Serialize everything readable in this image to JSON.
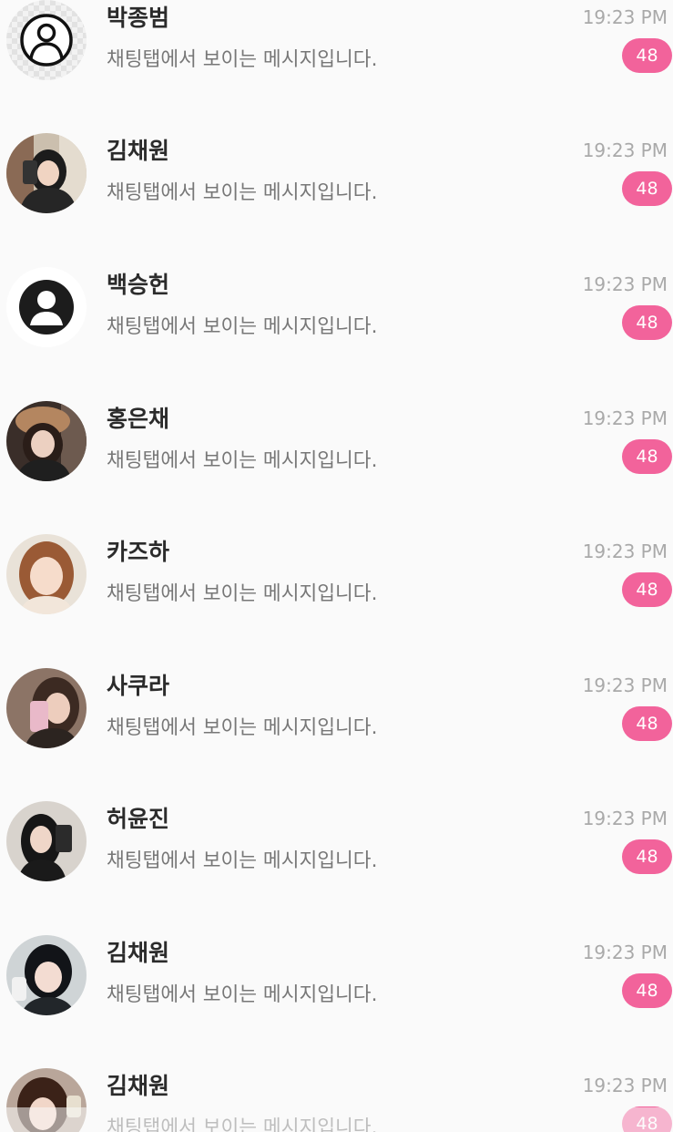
{
  "colors": {
    "badge": "#f2639b",
    "background": "#fafafa"
  },
  "chats": [
    {
      "name": "박종범",
      "preview": "채팅탭에서 보이는 메시지입니다.",
      "time": "19:23 PM",
      "unread": "48",
      "avatar": "outline-person-icon"
    },
    {
      "name": "김채원",
      "preview": "채팅탭에서 보이는 메시지입니다.",
      "time": "19:23 PM",
      "unread": "48",
      "avatar": "profile-photo"
    },
    {
      "name": "백승헌",
      "preview": "채팅탭에서 보이는 메시지입니다.",
      "time": "19:23 PM",
      "unread": "48",
      "avatar": "filled-person-icon"
    },
    {
      "name": "홍은채",
      "preview": "채팅탭에서 보이는 메시지입니다.",
      "time": "19:23 PM",
      "unread": "48",
      "avatar": "profile-photo"
    },
    {
      "name": "카즈하",
      "preview": "채팅탭에서 보이는 메시지입니다.",
      "time": "19:23 PM",
      "unread": "48",
      "avatar": "profile-photo"
    },
    {
      "name": "사쿠라",
      "preview": "채팅탭에서 보이는 메시지입니다.",
      "time": "19:23 PM",
      "unread": "48",
      "avatar": "profile-photo"
    },
    {
      "name": "허윤진",
      "preview": "채팅탭에서 보이는 메시지입니다.",
      "time": "19:23 PM",
      "unread": "48",
      "avatar": "profile-photo"
    },
    {
      "name": "김채원",
      "preview": "채팅탭에서 보이는 메시지입니다.",
      "time": "19:23 PM",
      "unread": "48",
      "avatar": "profile-photo"
    },
    {
      "name": "김채원",
      "preview": "채팅탭에서 보이는 메시지입니다.",
      "time": "19:23 PM",
      "unread": "48",
      "avatar": "profile-photo"
    }
  ]
}
